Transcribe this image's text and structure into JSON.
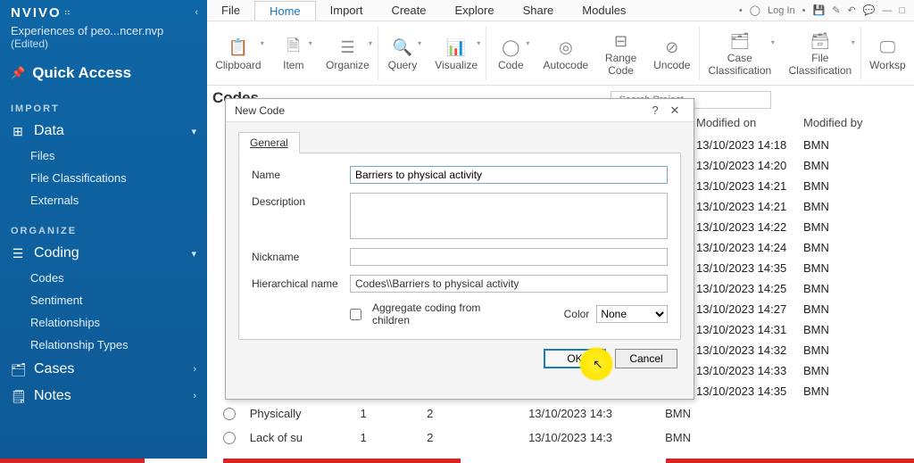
{
  "branding": {
    "name": "NVIVO"
  },
  "project": {
    "title": "Experiences of peo...ncer.nvp",
    "status": "(Edited)"
  },
  "quick_access": {
    "label": "Quick Access"
  },
  "sections": {
    "import_label": "IMPORT",
    "data": {
      "title": "Data",
      "items": [
        "Files",
        "File Classifications",
        "Externals"
      ]
    },
    "organize_label": "ORGANIZE",
    "coding": {
      "title": "Coding",
      "items": [
        "Codes",
        "Sentiment",
        "Relationships",
        "Relationship Types"
      ]
    },
    "cases": "Cases",
    "notes": "Notes"
  },
  "menubar": {
    "items": [
      "File",
      "Home",
      "Import",
      "Create",
      "Explore",
      "Share",
      "Modules"
    ],
    "active_index": 1,
    "right": {
      "login": "Log In"
    }
  },
  "ribbon": {
    "items": [
      {
        "label": "Clipboard"
      },
      {
        "label": "Item"
      },
      {
        "label": "Organize"
      },
      {
        "label": "Query"
      },
      {
        "label": "Visualize"
      },
      {
        "label": "Code"
      },
      {
        "label": "Autocode"
      },
      {
        "label": "Range",
        "label2": "Code"
      },
      {
        "label": "Uncode"
      },
      {
        "label": "Case",
        "label2": "Classification"
      },
      {
        "label": "File",
        "label2": "Classification"
      },
      {
        "label": "Worksp"
      }
    ]
  },
  "content": {
    "heading": "Codes",
    "search_placeholder": "Search Project"
  },
  "table": {
    "headers": {
      "mod_on": "Modified on",
      "mod_by": "Modified by"
    },
    "rows": [
      {
        "on": "13/10/2023 14:18",
        "by": "BMN"
      },
      {
        "on": "13/10/2023 14:20",
        "by": "BMN"
      },
      {
        "on": "13/10/2023 14:21",
        "by": "BMN"
      },
      {
        "on": "13/10/2023 14:21",
        "by": "BMN"
      },
      {
        "on": "13/10/2023 14:22",
        "by": "BMN"
      },
      {
        "on": "13/10/2023 14:24",
        "by": "BMN"
      },
      {
        "on": "13/10/2023 14:35",
        "by": "BMN"
      },
      {
        "on": "13/10/2023 14:25",
        "by": "BMN"
      },
      {
        "on": "13/10/2023 14:27",
        "by": "BMN"
      },
      {
        "on": "13/10/2023 14:31",
        "by": "BMN"
      },
      {
        "on": "13/10/2023 14:32",
        "by": "BMN"
      },
      {
        "on": "13/10/2023 14:33",
        "by": "BMN"
      },
      {
        "on": "13/10/2023 14:35",
        "by": "BMN"
      }
    ]
  },
  "table2": {
    "rows": [
      {
        "name": "Physically",
        "c1": "1",
        "c2": "2",
        "dt": "13/10/2023 14:3",
        "by": "BMN"
      },
      {
        "name": "Lack of su",
        "c1": "1",
        "c2": "2",
        "dt": "13/10/2023 14:3",
        "by": "BMN"
      }
    ]
  },
  "dialog": {
    "title": "New Code",
    "tab": "General",
    "fields": {
      "name_label": "Name",
      "name_value": "Barriers to physical activity",
      "desc_label": "Description",
      "desc_value": "",
      "nick_label": "Nickname",
      "nick_value": "",
      "hier_label": "Hierarchical name",
      "hier_value": "Codes\\\\Barriers to physical activity",
      "agg_label": "Aggregate coding from children",
      "color_label": "Color",
      "color_value": "None"
    },
    "buttons": {
      "ok": "OK",
      "cancel": "Cancel"
    }
  }
}
